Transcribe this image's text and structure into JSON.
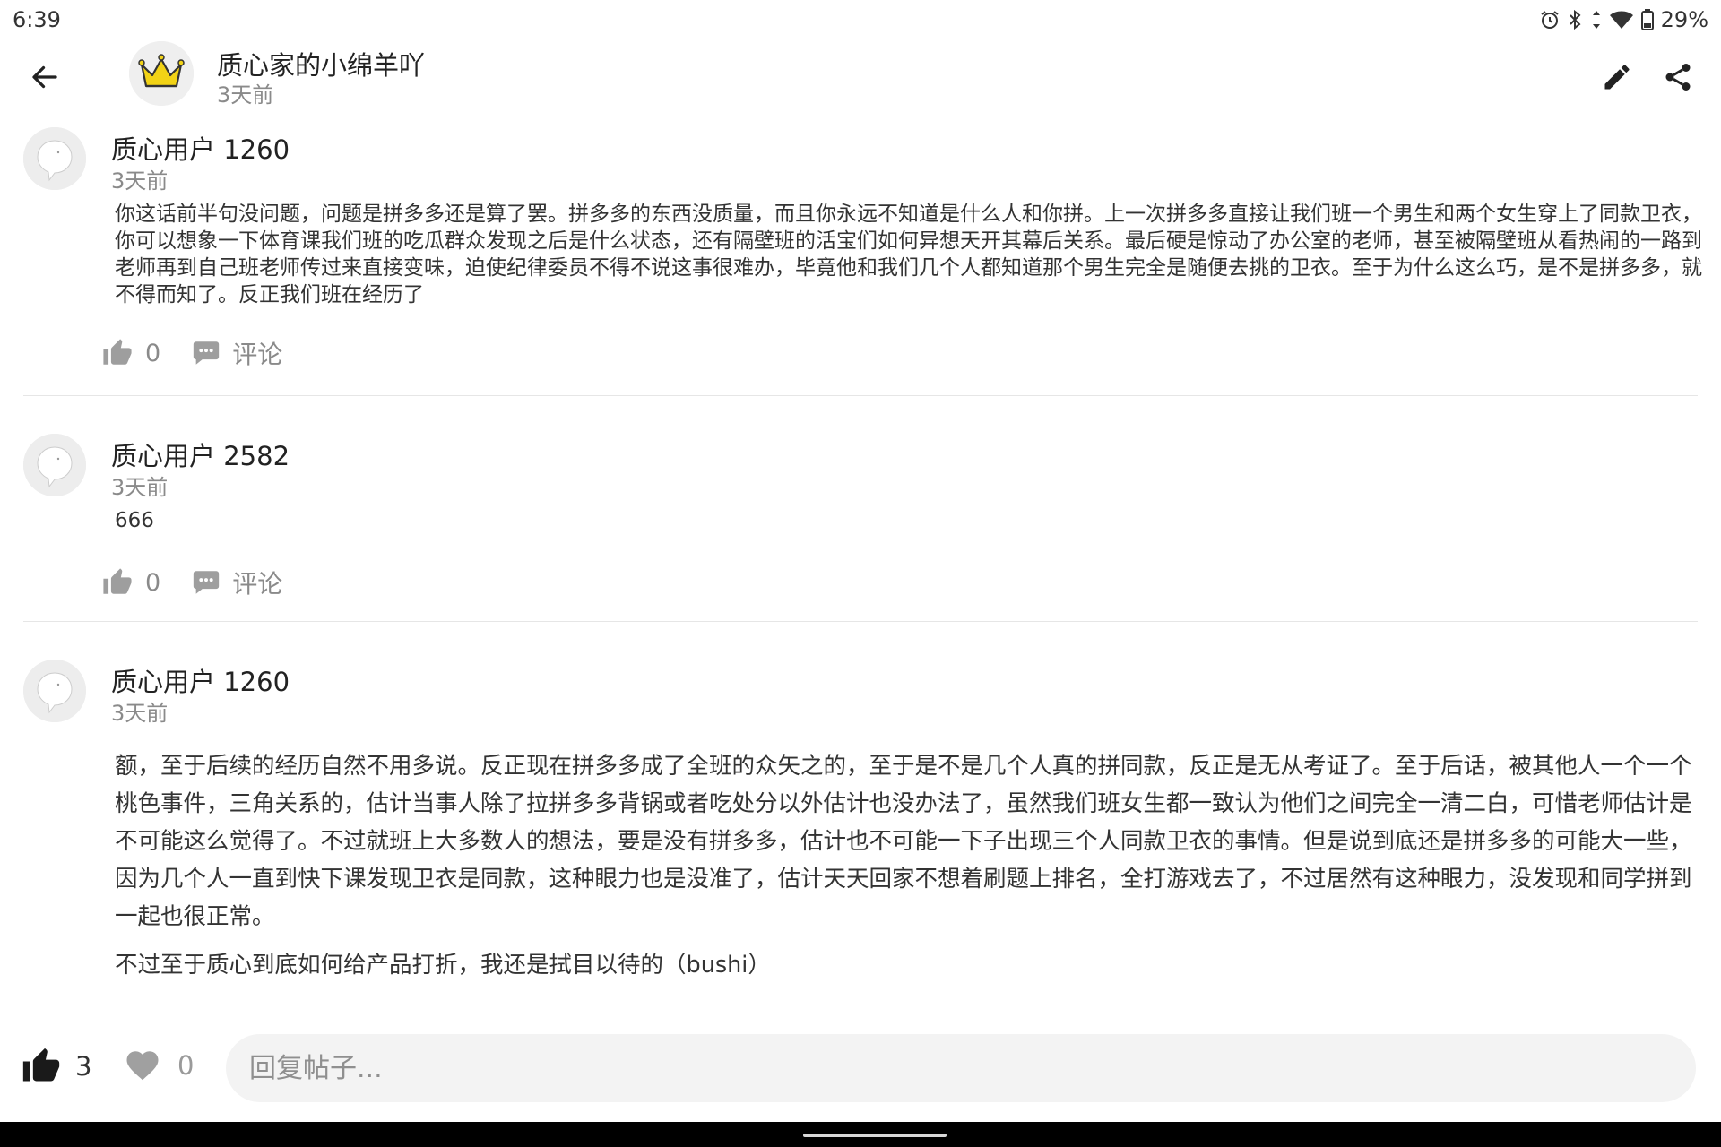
{
  "status_bar": {
    "time": "6:39",
    "battery": "29%",
    "icons": [
      "alarm-icon",
      "bluetooth-icon",
      "data-arrows-icon",
      "wifi-icon",
      "battery-icon"
    ]
  },
  "header": {
    "back_icon": "arrow-left-icon",
    "author_name": "质心家的小绵羊吖",
    "author_avatar": "crown-icon",
    "post_time": "3天前",
    "edit_icon": "pencil-icon",
    "share_icon": "share-icon"
  },
  "comments": [
    {
      "user": "质心用户 1260",
      "time": "3天前",
      "paragraphs": [
        "你这话前半句没问题，问题是拼多多还是算了罢。拼多多的东西没质量，而且你永远不知道是什么人和你拼。上一次拼多多直接让我们班一个男生和两个女生穿上了同款卫衣，你可以想象一下体育课我们班的吃瓜群众发现之后是什么状态，还有隔壁班的活宝们如何异想天开其幕后关系。最后硬是惊动了办公室的老师，甚至被隔壁班从看热闹的一路到老师再到自己班老师传过来直接变味，迫使纪律委员不得不说这事很难办，毕竟他和我们几个人都知道那个男生完全是随便去挑的卫衣。至于为什么这么巧，是不是拼多多，就不得而知了。反正我们班在经历了"
      ],
      "likes": "0",
      "comment_label": "评论"
    },
    {
      "user": "质心用户 2582",
      "time": "3天前",
      "paragraphs": [
        "666"
      ],
      "likes": "0",
      "comment_label": "评论"
    },
    {
      "user": "质心用户 1260",
      "time": "3天前",
      "paragraphs": [
        "额，至于后续的经历自然不用多说。反正现在拼多多成了全班的众矢之的，至于是不是几个人真的拼同款，反正是无从考证了。至于后话，被其他人一个一个桃色事件，三角关系的，估计当事人除了拉拼多多背锅或者吃处分以外估计也没办法了，虽然我们班女生都一致认为他们之间完全一清二白，可惜老师估计是不可能这么觉得了。不过就班上大多数人的想法，要是没有拼多多，估计也不可能一下子出现三个人同款卫衣的事情。但是说到底还是拼多多的可能大一些，因为几个人一直到快下课发现卫衣是同款，这种眼力也是没准了，估计天天回家不想着刷题上排名，全打游戏去了，不过居然有这种眼力，没发现和同学拼到一起也很正常。",
        "不过至于质心到底如何给产品打折，我还是拭目以待的（bushi）"
      ]
    }
  ],
  "bottom_bar": {
    "like_count": "3",
    "favorite_count": "0",
    "reply_placeholder": "回复帖子..."
  },
  "colors": {
    "muted_text": "#8a8a8a",
    "icon_gray": "#9e9e9e",
    "divider": "#e6e6e6",
    "input_bg": "#f3f3f3",
    "crown_yellow": "#f2d316"
  }
}
